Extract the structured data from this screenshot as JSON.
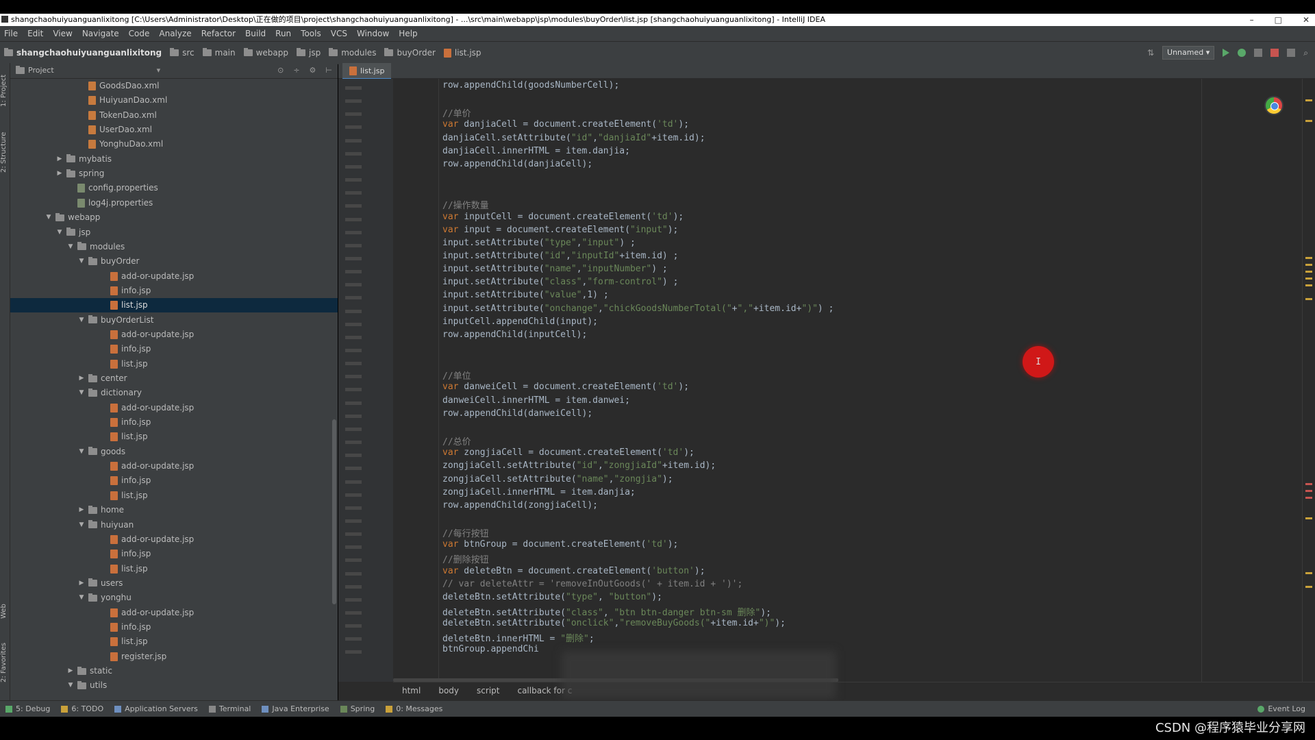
{
  "window": {
    "title": "shangchaohuiyuanguanlixitong [C:\\Users\\Administrator\\Desktop\\正在做的项目\\project\\shangchaohuiyuanguanlixitong] - ...\\src\\main\\webapp\\jsp\\modules\\buyOrder\\list.jsp [shangchaohuiyuanguanlixitong] - IntelliJ IDEA"
  },
  "menu": [
    "File",
    "Edit",
    "View",
    "Navigate",
    "Code",
    "Analyze",
    "Refactor",
    "Build",
    "Run",
    "Tools",
    "VCS",
    "Window",
    "Help"
  ],
  "breadcrumbs": [
    "shangchaohuiyuanguanlixitong",
    "src",
    "main",
    "webapp",
    "jsp",
    "modules",
    "buyOrder",
    "list.jsp"
  ],
  "run_config": "Unnamed",
  "left_tabs": [
    "1: Project",
    "2: Structure",
    "Web",
    "2: Favorites"
  ],
  "project_panel": {
    "title": "Project",
    "tree": [
      {
        "label": "GoodsDao.xml",
        "depth": 6,
        "type": "xml"
      },
      {
        "label": "HuiyuanDao.xml",
        "depth": 6,
        "type": "xml"
      },
      {
        "label": "TokenDao.xml",
        "depth": 6,
        "type": "xml"
      },
      {
        "label": "UserDao.xml",
        "depth": 6,
        "type": "xml"
      },
      {
        "label": "YonghuDao.xml",
        "depth": 6,
        "type": "xml"
      },
      {
        "label": "mybatis",
        "depth": 4,
        "type": "folder",
        "state": "collapsed"
      },
      {
        "label": "spring",
        "depth": 4,
        "type": "folder",
        "state": "collapsed"
      },
      {
        "label": "config.properties",
        "depth": 5,
        "type": "prop"
      },
      {
        "label": "log4j.properties",
        "depth": 5,
        "type": "prop"
      },
      {
        "label": "webapp",
        "depth": 3,
        "type": "folder",
        "state": "expanded"
      },
      {
        "label": "jsp",
        "depth": 4,
        "type": "folder",
        "state": "expanded"
      },
      {
        "label": "modules",
        "depth": 5,
        "type": "folder",
        "state": "expanded"
      },
      {
        "label": "buyOrder",
        "depth": 6,
        "type": "folder",
        "state": "expanded"
      },
      {
        "label": "add-or-update.jsp",
        "depth": 8,
        "type": "jsp"
      },
      {
        "label": "info.jsp",
        "depth": 8,
        "type": "jsp"
      },
      {
        "label": "list.jsp",
        "depth": 8,
        "type": "jsp",
        "selected": true
      },
      {
        "label": "buyOrderList",
        "depth": 6,
        "type": "folder",
        "state": "expanded"
      },
      {
        "label": "add-or-update.jsp",
        "depth": 8,
        "type": "jsp"
      },
      {
        "label": "info.jsp",
        "depth": 8,
        "type": "jsp"
      },
      {
        "label": "list.jsp",
        "depth": 8,
        "type": "jsp"
      },
      {
        "label": "center",
        "depth": 6,
        "type": "folder",
        "state": "collapsed"
      },
      {
        "label": "dictionary",
        "depth": 6,
        "type": "folder",
        "state": "expanded"
      },
      {
        "label": "add-or-update.jsp",
        "depth": 8,
        "type": "jsp"
      },
      {
        "label": "info.jsp",
        "depth": 8,
        "type": "jsp"
      },
      {
        "label": "list.jsp",
        "depth": 8,
        "type": "jsp"
      },
      {
        "label": "goods",
        "depth": 6,
        "type": "folder",
        "state": "expanded"
      },
      {
        "label": "add-or-update.jsp",
        "depth": 8,
        "type": "jsp"
      },
      {
        "label": "info.jsp",
        "depth": 8,
        "type": "jsp"
      },
      {
        "label": "list.jsp",
        "depth": 8,
        "type": "jsp"
      },
      {
        "label": "home",
        "depth": 6,
        "type": "folder",
        "state": "collapsed"
      },
      {
        "label": "huiyuan",
        "depth": 6,
        "type": "folder",
        "state": "expanded"
      },
      {
        "label": "add-or-update.jsp",
        "depth": 8,
        "type": "jsp"
      },
      {
        "label": "info.jsp",
        "depth": 8,
        "type": "jsp"
      },
      {
        "label": "list.jsp",
        "depth": 8,
        "type": "jsp"
      },
      {
        "label": "users",
        "depth": 6,
        "type": "folder",
        "state": "collapsed"
      },
      {
        "label": "yonghu",
        "depth": 6,
        "type": "folder",
        "state": "expanded"
      },
      {
        "label": "add-or-update.jsp",
        "depth": 8,
        "type": "jsp"
      },
      {
        "label": "info.jsp",
        "depth": 8,
        "type": "jsp"
      },
      {
        "label": "list.jsp",
        "depth": 8,
        "type": "jsp"
      },
      {
        "label": "register.jsp",
        "depth": 8,
        "type": "jsp"
      },
      {
        "label": "static",
        "depth": 5,
        "type": "folder",
        "state": "collapsed"
      },
      {
        "label": "utils",
        "depth": 5,
        "type": "folder",
        "state": "expanded"
      }
    ]
  },
  "editor": {
    "tab": "list.jsp",
    "lines": [
      "row.appendChild(goodsNumberCell);",
      "",
      "//单价",
      "var danjiaCell = document.createElement('td');",
      "danjiaCell.setAttribute(\"id\",\"danjiaId\"+item.id);",
      "danjiaCell.innerHTML = item.danjia;",
      "row.appendChild(danjiaCell);",
      "",
      "",
      "//操作数量",
      "var inputCell = document.createElement('td');",
      "var input = document.createElement(\"input\");",
      "input.setAttribute(\"type\",\"input\") ;",
      "input.setAttribute(\"id\",\"inputId\"+item.id) ;",
      "input.setAttribute(\"name\",\"inputNumber\") ;",
      "input.setAttribute(\"class\",\"form-control\") ;",
      "input.setAttribute(\"value\",1) ;",
      "input.setAttribute(\"onchange\",\"chickGoodsNumberTotal(\"+\",\"+item.id+\")\") ;",
      "inputCell.appendChild(input);",
      "row.appendChild(inputCell);",
      "",
      "",
      "//单位",
      "var danweiCell = document.createElement('td');",
      "danweiCell.innerHTML = item.danwei;",
      "row.appendChild(danweiCell);",
      "",
      "//总价",
      "var zongjiaCell = document.createElement('td');",
      "zongjiaCell.setAttribute(\"id\",\"zongjiaId\"+item.id);",
      "zongjiaCell.setAttribute(\"name\",\"zongjia\");",
      "zongjiaCell.innerHTML = item.danjia;",
      "row.appendChild(zongjiaCell);",
      "",
      "//每行按钮",
      "var btnGroup = document.createElement('td');",
      "//删除按钮",
      "var deleteBtn = document.createElement('button');",
      "// var deleteAttr = 'removeInOutGoods(' + item.id + ')';",
      "deleteBtn.setAttribute(\"type\", \"button\");",
      "deleteBtn.setAttribute(\"class\", \"btn btn-danger btn-sm 删除\");",
      "deleteBtn.setAttribute(\"onclick\",\"removeBuyGoods(\"+item.id+\")\");",
      "deleteBtn.innerHTML = \"删除\";",
      "btnGroup.appendChi"
    ],
    "cursor_glyph": "I"
  },
  "code_breadcrumbs": [
    "html",
    "body",
    "script",
    "callback for c"
  ],
  "bottom_tools": [
    {
      "label": "5: Debug",
      "icon": "debug-icon"
    },
    {
      "label": "6: TODO",
      "icon": "todo-icon"
    },
    {
      "label": "Application Servers",
      "icon": "server-icon"
    },
    {
      "label": "Terminal",
      "icon": "terminal-icon"
    },
    {
      "label": "Java Enterprise",
      "icon": "java-ee-icon"
    },
    {
      "label": "Spring",
      "icon": "spring-icon"
    },
    {
      "label": "0: Messages",
      "icon": "messages-icon"
    }
  ],
  "event_log": "Event Log",
  "watermark": "CSDN @程序猿毕业分享网",
  "colors": {
    "bg_editor": "#2b2b2b",
    "bg_panel": "#3c3f41",
    "selection": "#0d293e",
    "keyword": "#cc7832",
    "string": "#6a8759",
    "comment": "#808080"
  }
}
